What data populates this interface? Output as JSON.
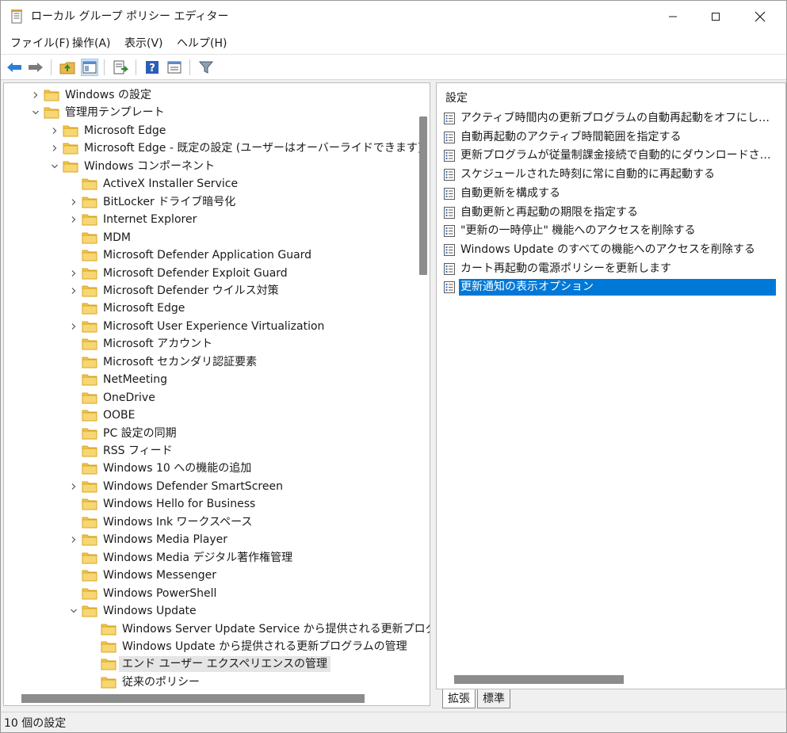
{
  "window": {
    "title": "ローカル グループ ポリシー エディター"
  },
  "menu": {
    "items": [
      "ファイル(F)",
      "操作(A)",
      "表示(V)",
      "ヘルプ(H)"
    ]
  },
  "toolbar": {
    "buttons": [
      "back-icon",
      "forward-icon",
      "up-folder-icon",
      "show-hide-tree-icon",
      "export-list-icon",
      "help-icon",
      "properties-icon",
      "filter-icon"
    ]
  },
  "tree": {
    "items": [
      {
        "label": "Windows の設定",
        "level": 1,
        "expander": "collapsed"
      },
      {
        "label": "管理用テンプレート",
        "level": 1,
        "expander": "expanded"
      },
      {
        "label": "Microsoft Edge",
        "level": 2,
        "expander": "collapsed"
      },
      {
        "label": "Microsoft Edge - 既定の設定 (ユーザーはオーバーライドできます)",
        "level": 2,
        "expander": "collapsed"
      },
      {
        "label": "Windows コンポーネント",
        "level": 2,
        "expander": "expanded"
      },
      {
        "label": "ActiveX Installer Service",
        "level": 3,
        "expander": "none"
      },
      {
        "label": "BitLocker ドライブ暗号化",
        "level": 3,
        "expander": "collapsed"
      },
      {
        "label": "Internet Explorer",
        "level": 3,
        "expander": "collapsed"
      },
      {
        "label": "MDM",
        "level": 3,
        "expander": "none"
      },
      {
        "label": "Microsoft Defender Application Guard",
        "level": 3,
        "expander": "none"
      },
      {
        "label": "Microsoft Defender Exploit Guard",
        "level": 3,
        "expander": "collapsed"
      },
      {
        "label": "Microsoft Defender ウイルス対策",
        "level": 3,
        "expander": "collapsed"
      },
      {
        "label": "Microsoft Edge",
        "level": 3,
        "expander": "none"
      },
      {
        "label": "Microsoft User Experience Virtualization",
        "level": 3,
        "expander": "collapsed"
      },
      {
        "label": "Microsoft アカウント",
        "level": 3,
        "expander": "none"
      },
      {
        "label": "Microsoft セカンダリ認証要素",
        "level": 3,
        "expander": "none"
      },
      {
        "label": "NetMeeting",
        "level": 3,
        "expander": "none"
      },
      {
        "label": "OneDrive",
        "level": 3,
        "expander": "none"
      },
      {
        "label": "OOBE",
        "level": 3,
        "expander": "none"
      },
      {
        "label": "PC 設定の同期",
        "level": 3,
        "expander": "none"
      },
      {
        "label": "RSS フィード",
        "level": 3,
        "expander": "none"
      },
      {
        "label": "Windows 10 への機能の追加",
        "level": 3,
        "expander": "none"
      },
      {
        "label": "Windows Defender SmartScreen",
        "level": 3,
        "expander": "collapsed"
      },
      {
        "label": "Windows Hello for Business",
        "level": 3,
        "expander": "none"
      },
      {
        "label": "Windows Ink ワークスペース",
        "level": 3,
        "expander": "none"
      },
      {
        "label": "Windows Media Player",
        "level": 3,
        "expander": "collapsed"
      },
      {
        "label": "Windows Media デジタル著作権管理",
        "level": 3,
        "expander": "none"
      },
      {
        "label": "Windows Messenger",
        "level": 3,
        "expander": "none"
      },
      {
        "label": "Windows PowerShell",
        "level": 3,
        "expander": "none"
      },
      {
        "label": "Windows Update",
        "level": 3,
        "expander": "expanded"
      },
      {
        "label": "Windows Server Update Service から提供される更新プログラム",
        "level": 4,
        "expander": "none"
      },
      {
        "label": "Windows Update から提供される更新プログラムの管理",
        "level": 4,
        "expander": "none"
      },
      {
        "label": "エンド ユーザー エクスペリエンスの管理",
        "level": 4,
        "expander": "none",
        "selected": true
      },
      {
        "label": "従来のポリシー",
        "level": 4,
        "expander": "none"
      }
    ]
  },
  "settings": {
    "column_header": "設定",
    "items": [
      {
        "label": "アクティブ時間内の更新プログラムの自動再起動をオフにします"
      },
      {
        "label": "自動再起動のアクティブ時間範囲を指定する"
      },
      {
        "label": "更新プログラムが従量制課金接続で自動的にダウンロードされるのを…"
      },
      {
        "label": "スケジュールされた時刻に常に自動的に再起動する"
      },
      {
        "label": "自動更新を構成する"
      },
      {
        "label": "自動更新と再起動の期限を指定する"
      },
      {
        "label": "\"更新の一時停止\" 機能へのアクセスを削除する"
      },
      {
        "label": "Windows Update のすべての機能へのアクセスを削除する"
      },
      {
        "label": "カート再起動の電源ポリシーを更新します"
      },
      {
        "label": "更新通知の表示オプション",
        "selected": true
      }
    ]
  },
  "tabs": {
    "extended": "拡張",
    "standard": "標準"
  },
  "status": {
    "text": "10 個の設定"
  },
  "colors": {
    "selection": "#0078d7",
    "folder": "#f2c94c",
    "folder_edge": "#d9a520"
  }
}
